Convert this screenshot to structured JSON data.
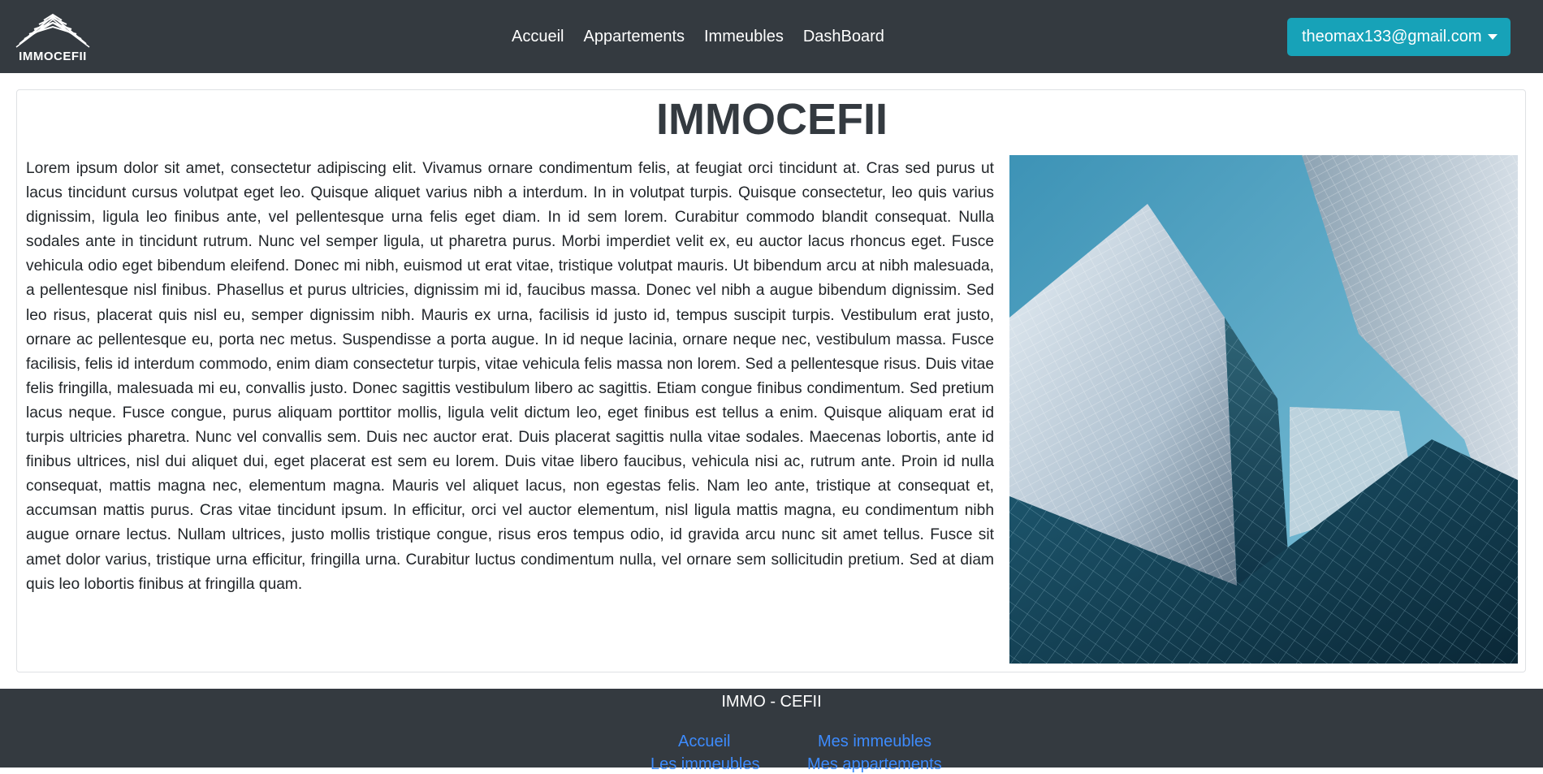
{
  "brand": {
    "logo_text": "IMMOCEFII"
  },
  "nav": {
    "links": [
      "Accueil",
      "Appartements",
      "Immeubles",
      "DashBoard"
    ]
  },
  "user_menu": {
    "email": "theomax133@gmail.com"
  },
  "main": {
    "title": "IMMOCEFII",
    "body": "Lorem ipsum dolor sit amet, consectetur adipiscing elit. Vivamus ornare condimentum felis, at feugiat orci tincidunt at. Cras sed purus ut lacus tincidunt cursus volutpat eget leo. Quisque aliquet varius nibh a interdum. In in volutpat turpis. Quisque consectetur, leo quis varius dignissim, ligula leo finibus ante, vel pellentesque urna felis eget diam. In id sem lorem. Curabitur commodo blandit consequat. Nulla sodales ante in tincidunt rutrum. Nunc vel semper ligula, ut pharetra purus. Morbi imperdiet velit ex, eu auctor lacus rhoncus eget. Fusce vehicula odio eget bibendum eleifend. Donec mi nibh, euismod ut erat vitae, tristique volutpat mauris. Ut bibendum arcu at nibh malesuada, a pellentesque nisl finibus. Phasellus et purus ultricies, dignissim mi id, faucibus massa. Donec vel nibh a augue bibendum dignissim. Sed leo risus, placerat quis nisl eu, semper dignissim nibh. Mauris ex urna, facilisis id justo id, tempus suscipit turpis. Vestibulum erat justo, ornare ac pellentesque eu, porta nec metus. Suspendisse a porta augue. In id neque lacinia, ornare neque nec, vestibulum massa. Fusce facilisis, felis id interdum commodo, enim diam consectetur turpis, vitae vehicula felis massa non lorem. Sed a pellentesque risus. Duis vitae felis fringilla, malesuada mi eu, convallis justo. Donec sagittis vestibulum libero ac sagittis. Etiam congue finibus condimentum. Sed pretium lacus neque. Fusce congue, purus aliquam porttitor mollis, ligula velit dictum leo, eget finibus est tellus a enim. Quisque aliquam erat id turpis ultricies pharetra. Nunc vel convallis sem. Duis nec auctor erat. Duis placerat sagittis nulla vitae sodales. Maecenas lobortis, ante id finibus ultrices, nisl dui aliquet dui, eget placerat est sem eu lorem. Duis vitae libero faucibus, vehicula nisi ac, rutrum ante. Proin id nulla consequat, mattis magna nec, elementum magna. Mauris vel aliquet lacus, non egestas felis. Nam leo ante, tristique at consequat et, accumsan mattis purus. Cras vitae tincidunt ipsum. In efficitur, orci vel auctor elementum, nisl ligula mattis magna, eu condimentum nibh augue ornare lectus. Nullam ultrices, justo mollis tristique congue, risus eros tempus odio, id gravida arcu nunc sit amet tellus. Fusce sit amet dolor varius, tristique urna efficitur, fringilla urna. Curabitur luctus condimentum nulla, vel ornare sem sollicitudin pretium. Sed at diam quis leo lobortis finibus at fringilla quam."
  },
  "footer": {
    "title": "IMMO - CEFII",
    "links": [
      "Accueil",
      "Mes immeubles",
      "Les immeubles",
      "Mes appartements"
    ]
  },
  "colors": {
    "navbar_bg": "#343a40",
    "accent": "#17a2b8",
    "link": "#3d8bfd"
  }
}
